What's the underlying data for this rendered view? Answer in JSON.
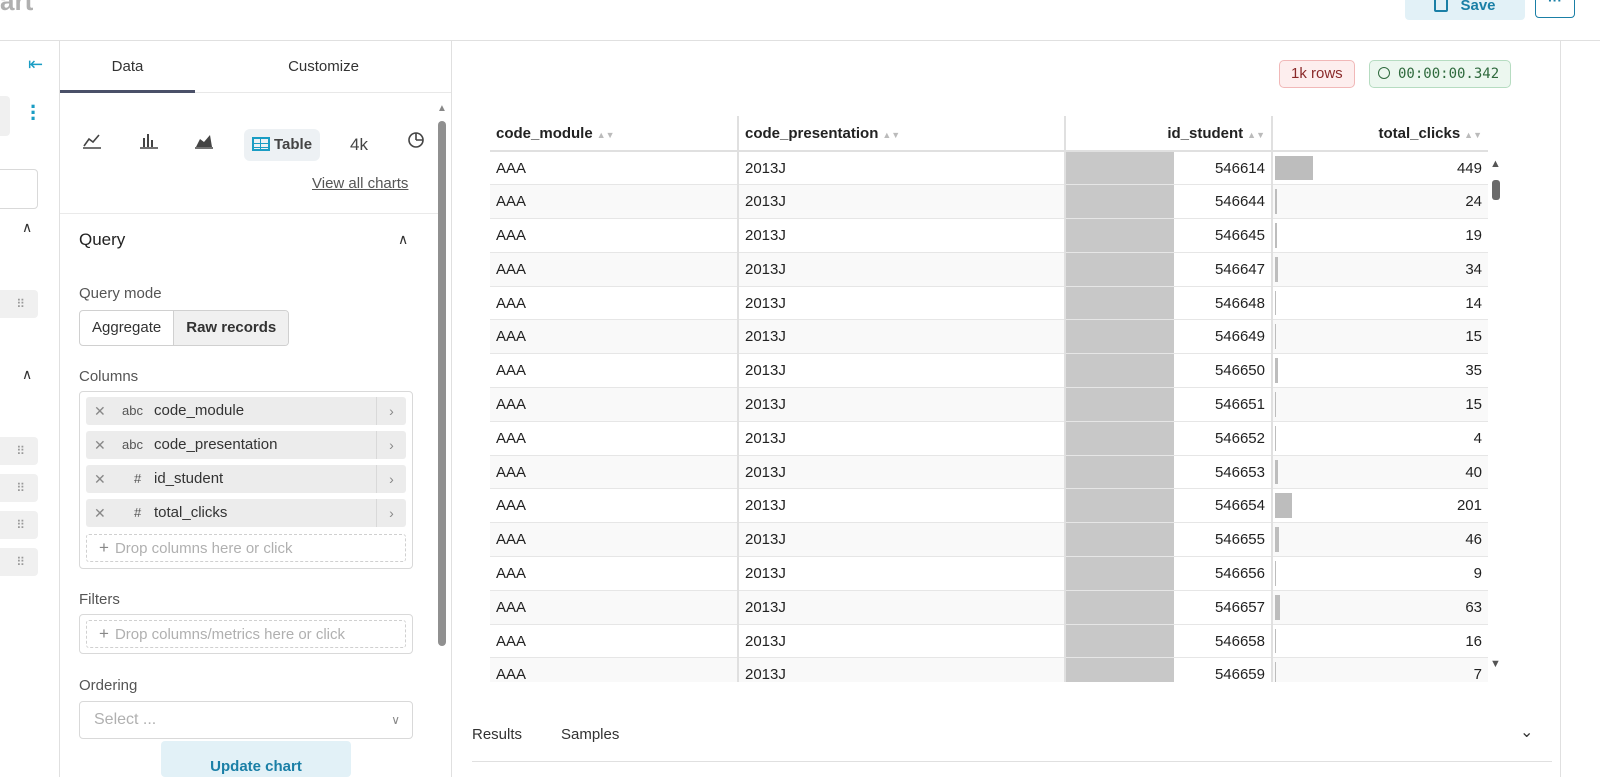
{
  "header": {
    "title_fragment": "art",
    "save_label": "Save",
    "more_label": "···"
  },
  "panel": {
    "tabs": [
      "Data",
      "Customize"
    ],
    "chart_types": [
      "line-chart-icon",
      "bar-chart-icon",
      "area-chart-icon",
      "Table",
      "4k",
      "pie-chart-icon"
    ],
    "view_all_label": "View all charts",
    "query_title": "Query",
    "query_mode_label": "Query mode",
    "query_modes": [
      "Aggregate",
      "Raw records"
    ],
    "columns_label": "Columns",
    "columns": [
      {
        "type": "abc",
        "name": "code_module"
      },
      {
        "type": "abc",
        "name": "code_presentation"
      },
      {
        "type": "#",
        "name": "id_student"
      },
      {
        "type": "#",
        "name": "total_clicks"
      }
    ],
    "columns_drop": "Drop columns here or click",
    "filters_label": "Filters",
    "filters_drop": "Drop columns/metrics here or click",
    "ordering_label": "Ordering",
    "ordering_placeholder": "Select ...",
    "update_label": "Update chart"
  },
  "results": {
    "rows_badge": "1k rows",
    "time_badge": "00:00:00.342",
    "headers": [
      "code_module",
      "code_presentation",
      "id_student",
      "total_clicks"
    ],
    "rows": [
      [
        "AAA",
        "2013J",
        "546614",
        "449"
      ],
      [
        "AAA",
        "2013J",
        "546644",
        "24"
      ],
      [
        "AAA",
        "2013J",
        "546645",
        "19"
      ],
      [
        "AAA",
        "2013J",
        "546647",
        "34"
      ],
      [
        "AAA",
        "2013J",
        "546648",
        "14"
      ],
      [
        "AAA",
        "2013J",
        "546649",
        "15"
      ],
      [
        "AAA",
        "2013J",
        "546650",
        "35"
      ],
      [
        "AAA",
        "2013J",
        "546651",
        "15"
      ],
      [
        "AAA",
        "2013J",
        "546652",
        "4"
      ],
      [
        "AAA",
        "2013J",
        "546653",
        "40"
      ],
      [
        "AAA",
        "2013J",
        "546654",
        "201"
      ],
      [
        "AAA",
        "2013J",
        "546655",
        "46"
      ],
      [
        "AAA",
        "2013J",
        "546656",
        "9"
      ],
      [
        "AAA",
        "2013J",
        "546657",
        "63"
      ],
      [
        "AAA",
        "2013J",
        "546658",
        "16"
      ],
      [
        "AAA",
        "2013J",
        "546659",
        "7"
      ]
    ],
    "bottom_tabs": [
      "Results",
      "Samples"
    ]
  },
  "colors": {
    "accent": "#1a9dc4",
    "save_bg": "#e2f1f7"
  }
}
